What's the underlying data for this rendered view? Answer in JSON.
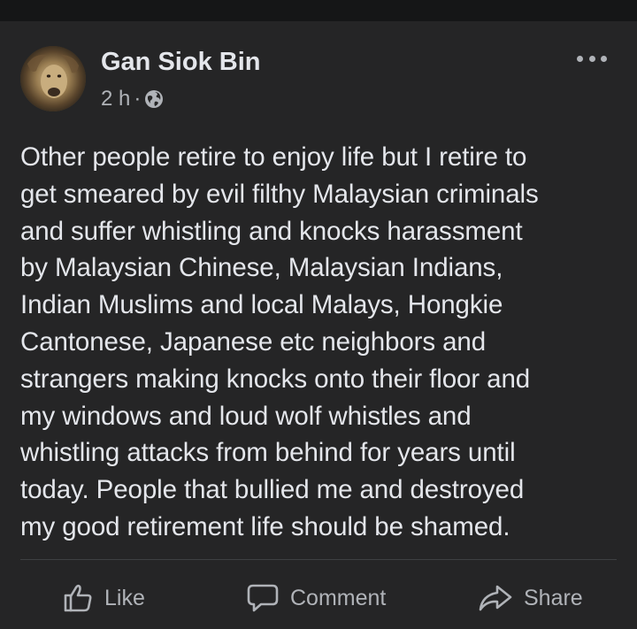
{
  "post": {
    "author": "Gan Siok Bin",
    "time": "2 h",
    "separator": "·",
    "audience_icon": "globe-icon",
    "more_icon": "more-horizontal-icon",
    "text": "Other people retire to enjoy life but I retire to\nget smeared by evil filthy Malaysian criminals\nand suffer whistling and knocks harassment\nby Malaysian Chinese, Malaysian Indians,\nIndian Muslims and local Malays, Hongkie\nCantonese,  Japanese etc neighbors and\nstrangers making knocks onto their floor and\nmy windows and loud wolf whistles and\nwhistling attacks from behind for years until\ntoday. People that bullied me and destroyed\nmy good retirement life should be shamed."
  },
  "actions": {
    "like": "Like",
    "comment": "Comment",
    "share": "Share"
  },
  "colors": {
    "background": "#252526",
    "text_primary": "#e4e6eb",
    "text_secondary": "#b0b3b8",
    "divider": "#3e4042"
  }
}
